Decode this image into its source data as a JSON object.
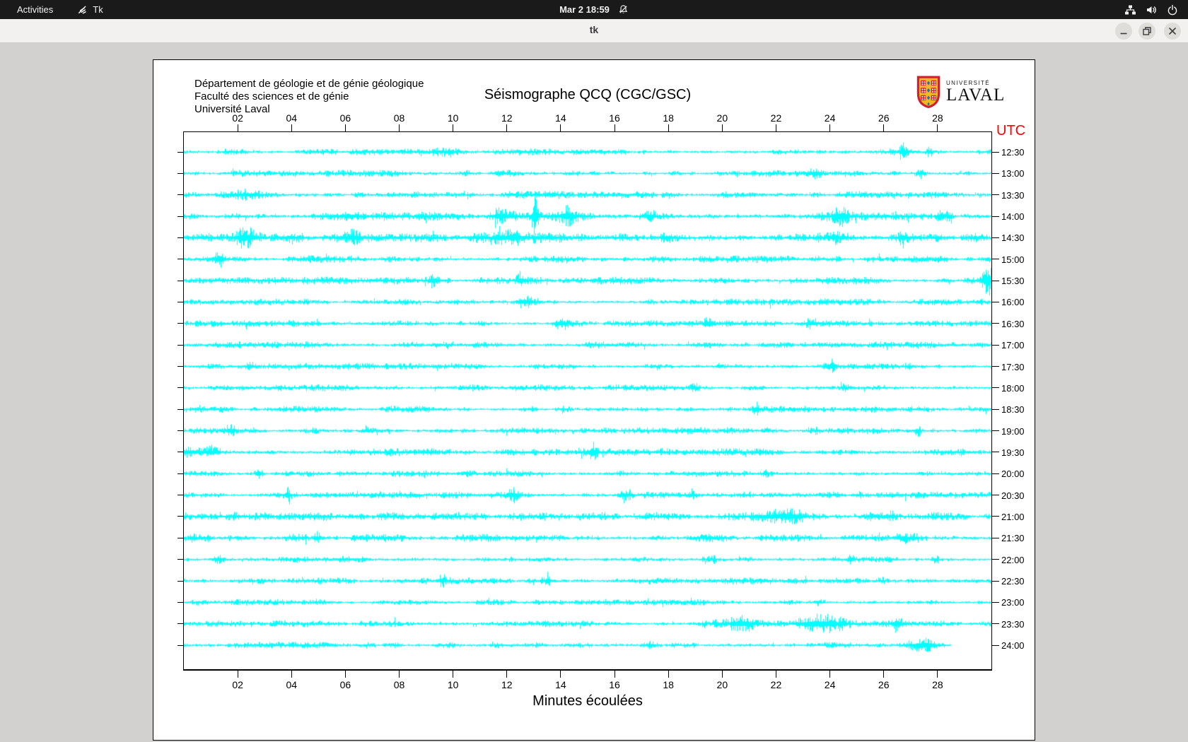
{
  "top_bar": {
    "activities": "Activities",
    "app_label": "Tk",
    "clock": "Mar 2 18:59"
  },
  "window": {
    "title": "tk",
    "controls": [
      "minimize",
      "restore",
      "close"
    ]
  },
  "icons": {
    "top_left_app": "tk-feather-icon",
    "clock_side": "notifications-disabled-icon",
    "status": [
      "network-wired-icon",
      "volume-icon",
      "power-icon"
    ]
  },
  "canvas": {
    "header_lines": [
      "Département de géologie et de génie géologique",
      "Faculté des sciences et de génie",
      "Université Laval"
    ],
    "title": "Séismographe QCQ (CGC/GSC)",
    "logo_line1": "UNIVERSITÉ",
    "logo_line2": "LAVAL",
    "utc_label": "UTC",
    "xlabel": "Minutes écoulées"
  },
  "chart_data": {
    "type": "line",
    "subtype": "helicorder-seismogram",
    "title": "Séismographe QCQ (CGC/GSC)",
    "xlabel": "Minutes écoulées",
    "x_range_minutes": [
      0,
      30
    ],
    "x_ticks": [
      "02",
      "04",
      "06",
      "08",
      "10",
      "12",
      "14",
      "16",
      "18",
      "20",
      "22",
      "24",
      "26",
      "28"
    ],
    "y_axis_right_label": "UTC",
    "trace_color": "#00ffff",
    "utc_color": "#ff0000",
    "grid": false,
    "rows": [
      {
        "time": "12:30",
        "base": 1.0,
        "events": [
          [
            10.0,
            0.6,
            0.5
          ],
          [
            26.7,
            2.6,
            0.09
          ],
          [
            27.7,
            2.0,
            0.09
          ]
        ]
      },
      {
        "time": "13:00",
        "base": 1.0,
        "events": [
          [
            12.0,
            0.5,
            0.6
          ],
          [
            23.4,
            1.2,
            0.2
          ],
          [
            27.4,
            1.6,
            0.15
          ]
        ]
      },
      {
        "time": "13:30",
        "base": 1.1,
        "events": [
          [
            2.5,
            0.9,
            0.4
          ],
          [
            18.0,
            1.5,
            0.15
          ]
        ]
      },
      {
        "time": "14:00",
        "base": 1.3,
        "events": [
          [
            11.7,
            1.8,
            0.3
          ],
          [
            13.03,
            6.0,
            0.07
          ],
          [
            14.2,
            1.8,
            0.25
          ],
          [
            17.3,
            1.5,
            0.35
          ],
          [
            24.4,
            1.8,
            0.25
          ],
          [
            28.2,
            2.0,
            0.18
          ]
        ]
      },
      {
        "time": "14:30",
        "base": 1.4,
        "events": [
          [
            2.3,
            1.6,
            0.3
          ],
          [
            4.0,
            1.8,
            0.35
          ],
          [
            6.3,
            1.5,
            0.15
          ],
          [
            11.5,
            1.5,
            0.9
          ],
          [
            17.9,
            1.5,
            0.15
          ],
          [
            23.5,
            1.4,
            0.7
          ],
          [
            26.7,
            1.7,
            0.12
          ]
        ]
      },
      {
        "time": "15:00",
        "base": 1.1,
        "events": [
          [
            1.3,
            1.6,
            0.12
          ],
          [
            23.5,
            1.4,
            0.15
          ]
        ]
      },
      {
        "time": "15:30",
        "base": 1.1,
        "events": [
          [
            9.3,
            1.5,
            0.12
          ],
          [
            12.5,
            1.5,
            0.12
          ],
          [
            29.85,
            6.5,
            0.12
          ]
        ]
      },
      {
        "time": "16:00",
        "base": 1.0,
        "events": [
          [
            12.7,
            1.8,
            0.2
          ]
        ]
      },
      {
        "time": "16:30",
        "base": 1.0,
        "events": [
          [
            14.0,
            1.6,
            0.15
          ],
          [
            19.5,
            1.8,
            0.12
          ],
          [
            23.3,
            1.5,
            0.12
          ]
        ]
      },
      {
        "time": "17:00",
        "base": 1.0,
        "events": [
          [
            8.5,
            1.0,
            0.3
          ]
        ]
      },
      {
        "time": "17:30",
        "base": 1.0,
        "events": [
          [
            2.5,
            1.6,
            0.12
          ],
          [
            24.0,
            1.6,
            0.12
          ]
        ]
      },
      {
        "time": "18:00",
        "base": 1.0,
        "events": [
          [
            19.0,
            1.8,
            0.12
          ],
          [
            24.5,
            1.6,
            0.12
          ]
        ]
      },
      {
        "time": "18:30",
        "base": 1.0,
        "events": [
          [
            14.1,
            2.0,
            0.15
          ],
          [
            20.2,
            1.6,
            0.12
          ],
          [
            21.3,
            1.6,
            0.12
          ]
        ]
      },
      {
        "time": "19:00",
        "base": 1.0,
        "events": [
          [
            1.7,
            1.6,
            0.12
          ],
          [
            6.7,
            1.6,
            0.12
          ],
          [
            23.4,
            1.6,
            0.12
          ],
          [
            27.3,
            2.8,
            0.08
          ]
        ]
      },
      {
        "time": "19:30",
        "base": 1.2,
        "events": [
          [
            0.6,
            1.4,
            0.7
          ],
          [
            15.2,
            1.8,
            0.12
          ]
        ]
      },
      {
        "time": "20:00",
        "base": 1.0,
        "events": [
          [
            2.8,
            1.6,
            0.12
          ],
          [
            21.6,
            1.6,
            0.12
          ]
        ]
      },
      {
        "time": "20:30",
        "base": 1.0,
        "events": [
          [
            3.85,
            3.6,
            0.07
          ],
          [
            12.2,
            1.7,
            0.12
          ],
          [
            16.4,
            1.5,
            0.12
          ],
          [
            18.9,
            1.5,
            0.12
          ]
        ]
      },
      {
        "time": "21:00",
        "base": 1.3,
        "events": [
          [
            1.5,
            1.2,
            0.9
          ],
          [
            22.5,
            1.4,
            0.7
          ],
          [
            26.3,
            1.5,
            0.15
          ]
        ]
      },
      {
        "time": "21:30",
        "base": 1.2,
        "events": [
          [
            0.5,
            1.5,
            0.35
          ],
          [
            5.0,
            1.6,
            0.1
          ],
          [
            27.0,
            1.5,
            0.35
          ]
        ]
      },
      {
        "time": "22:00",
        "base": 1.0,
        "events": [
          [
            1.2,
            1.5,
            0.12
          ],
          [
            19.7,
            1.5,
            0.12
          ],
          [
            24.75,
            4.0,
            0.07
          ],
          [
            27.9,
            1.5,
            0.12
          ]
        ]
      },
      {
        "time": "22:30",
        "base": 1.0,
        "events": [
          [
            9.6,
            1.7,
            0.12
          ],
          [
            13.5,
            1.5,
            0.12
          ],
          [
            25.9,
            1.7,
            0.12
          ]
        ]
      },
      {
        "time": "23:00",
        "base": 0.9,
        "events": [
          [
            23.6,
            1.6,
            0.12
          ]
        ]
      },
      {
        "time": "23:30",
        "base": 1.0,
        "events": [
          [
            20.2,
            2.2,
            0.7
          ],
          [
            23.7,
            2.2,
            0.6
          ],
          [
            26.5,
            1.7,
            0.15
          ]
        ]
      },
      {
        "time": "24:00",
        "base": 1.0,
        "end_min": 28.5,
        "events": [
          [
            13.2,
            1.5,
            0.15
          ],
          [
            17.3,
            1.6,
            0.12
          ],
          [
            27.6,
            2.0,
            0.4
          ]
        ]
      }
    ]
  }
}
